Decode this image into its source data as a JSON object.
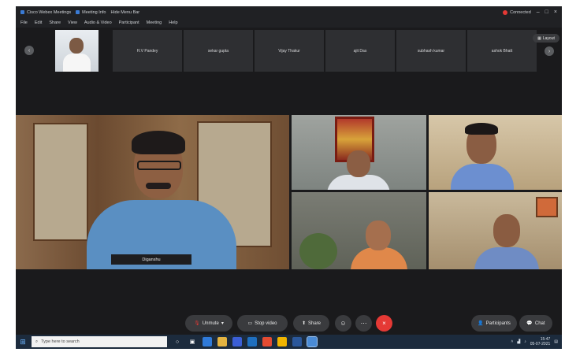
{
  "window": {
    "title": "Cisco Webex Meetings",
    "tab2": "Meeting Info",
    "tab3": "Hide Menu Bar",
    "status": "Connected"
  },
  "menu": [
    "File",
    "Edit",
    "Share",
    "View",
    "Audio & Video",
    "Participant",
    "Meeting",
    "Help"
  ],
  "filmstrip": {
    "tiles": [
      "H.V Pandey",
      "sekar gupta",
      "Vijay Thakur",
      "ajit Das",
      "subhash kumar",
      "ashok Bhatt"
    ],
    "layout_label": "Layout"
  },
  "videos": {
    "main_name": "Diganshu"
  },
  "controls": {
    "unmute": "Unmute",
    "stop_video": "Stop video",
    "share": "Share",
    "participants": "Participants",
    "chat": "Chat"
  },
  "taskbar": {
    "search_placeholder": "Type here to search",
    "time": "15:47",
    "date": "05-07-2021"
  },
  "colors": {
    "app_bg": "#1a1a1c",
    "end_call": "#e53935",
    "taskbar": "#1c2b3d"
  }
}
